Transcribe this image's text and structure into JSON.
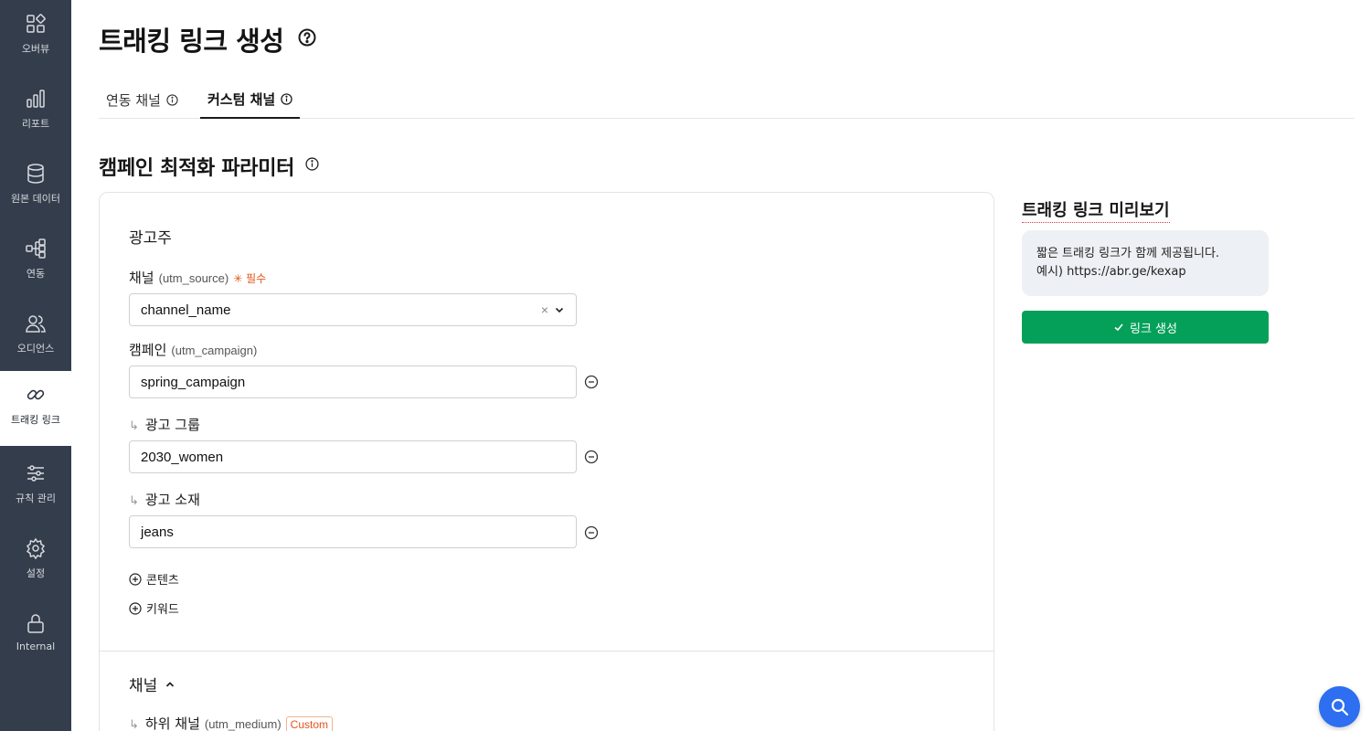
{
  "sidebar": {
    "items": [
      {
        "label": "오버뷰",
        "icon": "grid-icon",
        "active": false
      },
      {
        "label": "리포트",
        "icon": "bar-chart-icon",
        "active": false
      },
      {
        "label": "원본 데이터",
        "icon": "database-icon",
        "active": false
      },
      {
        "label": "연동",
        "icon": "hierarchy-icon",
        "active": false
      },
      {
        "label": "오디언스",
        "icon": "users-icon",
        "active": false
      },
      {
        "label": "트래킹 링크",
        "icon": "link-icon",
        "active": true
      },
      {
        "label": "규칙 관리",
        "icon": "sliders-icon",
        "active": false
      },
      {
        "label": "설정",
        "icon": "gear-icon",
        "active": false
      },
      {
        "label": "Internal",
        "icon": "lock-icon",
        "active": false
      }
    ]
  },
  "header": {
    "title": "트래킹 링크 생성",
    "tabs": [
      {
        "label": "연동 채널",
        "active": false
      },
      {
        "label": "커스텀 채널",
        "active": true
      }
    ]
  },
  "section": {
    "title": "캠페인 최적화 파라미터"
  },
  "advertiser": {
    "title": "광고주",
    "channel": {
      "label": "채널",
      "hint": "(utm_source)",
      "required": "필수",
      "value": "channel_name",
      "clear": "×"
    },
    "campaign": {
      "label": "캠페인",
      "hint": "(utm_campaign)",
      "value": "spring_campaign"
    },
    "ad_group": {
      "arrow": "↳",
      "label": "광고 그룹",
      "value": "2030_women"
    },
    "creative": {
      "arrow": "↳",
      "label": "광고 소재",
      "value": "jeans"
    },
    "add_content": "콘텐츠",
    "add_keyword": "키워드"
  },
  "channel_group": {
    "title": "채널",
    "sub_channel": {
      "arrow": "↳",
      "label": "하위 채널",
      "hint": "(utm_medium)",
      "badge": "Custom"
    }
  },
  "preview": {
    "title": "트래킹 링크 미리보기",
    "line1": "짧은 트래킹 링크가 함께 제공됩니다.",
    "line2": "예시) https://abr.ge/kexap",
    "button": "링크 생성"
  },
  "colors": {
    "sidebar_bg": "#343d4b",
    "accent_green": "#04a05a",
    "required_orange": "#e0551b",
    "fab_blue": "#2e6ef0"
  }
}
